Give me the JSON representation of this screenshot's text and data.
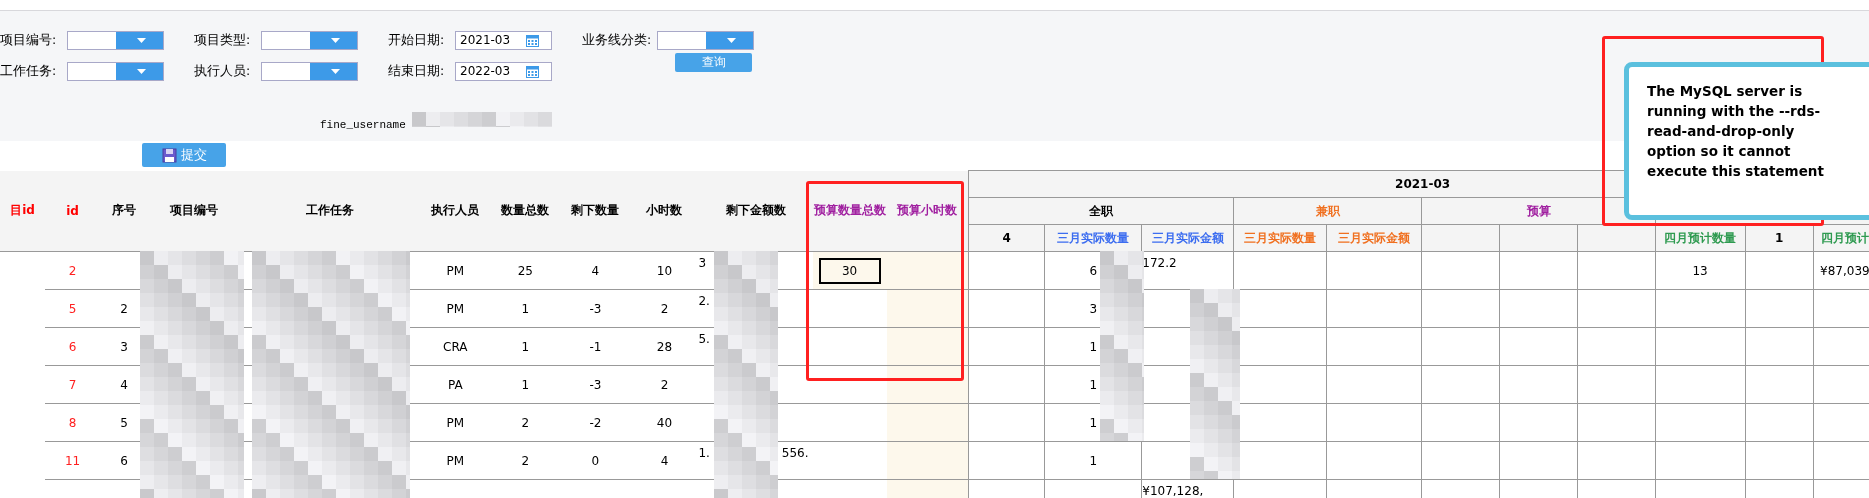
{
  "filters": [
    {
      "label": "项目编号:",
      "kind": "select"
    },
    {
      "label": "项目类型:",
      "kind": "select"
    },
    {
      "label": "开始日期:",
      "kind": "date",
      "value": "2021-03"
    },
    {
      "label": "业务线分类:",
      "kind": "select"
    },
    {
      "label": "工作任务:",
      "kind": "select"
    },
    {
      "label": "执行人员:",
      "kind": "select"
    },
    {
      "label": "结束日期:",
      "kind": "date",
      "value": "2022-03"
    }
  ],
  "query_button": "查询",
  "username_label": "fine_username",
  "submit_button": "提交",
  "table": {
    "columns": [
      {
        "label": "目id",
        "color": "#ff0000"
      },
      {
        "label": "id",
        "color": "#ff0000"
      },
      {
        "label": "序号",
        "color": "#000000"
      },
      {
        "label": "项目编号",
        "color": "#000000"
      },
      {
        "label": "工作任务",
        "color": "#000000"
      },
      {
        "label": "执行人员",
        "color": "#000000"
      },
      {
        "label": "数量总数",
        "color": "#000000"
      },
      {
        "label": "剩下数量",
        "color": "#000000"
      },
      {
        "label": "小时数",
        "color": "#000000"
      },
      {
        "label": "剩下金额数",
        "color": "#000000"
      },
      {
        "label": "预算数量总数",
        "color": "#a020a0"
      },
      {
        "label": "预算小时数",
        "color": "#a020a0"
      }
    ],
    "group_title": "2021-03",
    "groups": [
      {
        "label": "全职",
        "color": "#000000"
      },
      {
        "label": "兼职",
        "color": "#f07020"
      },
      {
        "label": "预算",
        "color": "#a020a0"
      }
    ],
    "subcolumns": [
      {
        "label": "4",
        "color": "#000000"
      },
      {
        "label": "三月实际数量",
        "color": "#3c6df0"
      },
      {
        "label": "三月实际金额",
        "color": "#3c6df0"
      },
      {
        "label": "三月实际数量",
        "color": "#f07020"
      },
      {
        "label": "三月实际金额",
        "color": "#f07020"
      },
      {
        "label": "四月预计数量",
        "color": "#2e9a50"
      },
      {
        "label": "1",
        "color": "#000000"
      },
      {
        "label": "四月预计",
        "color": "#2e9a50"
      }
    ],
    "rows": [
      {
        "selected": true,
        "cells": [
          "",
          "2",
          "",
          "",
          "",
          "PM",
          "25",
          "4",
          "10",
          "3",
          "30",
          "",
          "",
          "6",
          "172.2",
          "",
          "",
          "",
          "",
          "",
          "13",
          "",
          "¥87,039"
        ]
      },
      {
        "selected": false,
        "cells": [
          "",
          "5",
          "2",
          "",
          "",
          "PM",
          "1",
          "-3",
          "2",
          "2.",
          "",
          "",
          "",
          "3",
          "",
          "",
          "",
          "",
          "",
          "",
          "",
          "",
          ""
        ]
      },
      {
        "selected": false,
        "cells": [
          "",
          "6",
          "3",
          "",
          "",
          "CRA",
          "1",
          "-1",
          "28",
          "5.",
          "",
          "",
          "",
          "1",
          "",
          "",
          "",
          "",
          "",
          "",
          "",
          "",
          ""
        ]
      },
      {
        "selected": false,
        "cells": [
          "",
          "7",
          "4",
          "",
          "",
          "PA",
          "1",
          "-3",
          "2",
          "",
          "",
          "",
          "",
          "1",
          "",
          "",
          "",
          "",
          "",
          "",
          "",
          "",
          ""
        ]
      },
      {
        "selected": false,
        "cells": [
          "",
          "8",
          "5",
          "",
          "",
          "PM",
          "2",
          "-2",
          "40",
          "",
          "",
          "",
          "",
          "1",
          "",
          "",
          "",
          "",
          "",
          "",
          "",
          "",
          ""
        ]
      },
      {
        "selected": false,
        "cells": [
          "",
          "11",
          "6",
          "",
          "",
          "PM",
          "2",
          "0",
          "4",
          [
            "1.",
            "556."
          ],
          "",
          "",
          "",
          "1",
          "",
          "",
          "",
          "",
          "",
          "",
          "",
          "",
          ""
        ]
      },
      {
        "selected": false,
        "cells": [
          "",
          "",
          "",
          "",
          "",
          "",
          "",
          "",
          "",
          "",
          "",
          "",
          "",
          "",
          "¥107,128,",
          "",
          "",
          "",
          "",
          "",
          "",
          "",
          ""
        ]
      }
    ]
  },
  "tooltip": {
    "message": "The MySQL server is running with the --rds-read-and-drop-only option so it cannot execute this statement"
  }
}
